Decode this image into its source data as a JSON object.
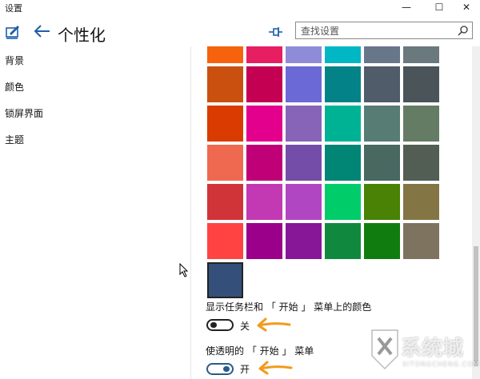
{
  "window": {
    "title": "设置",
    "minimize_glyph": "—",
    "maximize_glyph": "☐",
    "close_glyph": "✕"
  },
  "header": {
    "title": "个性化",
    "back_icon": "back-arrow-icon",
    "app_icon": "personalization-icon",
    "pin_icon": "pin-icon"
  },
  "search": {
    "placeholder": "查找设置",
    "value": "",
    "icon": "search-icon"
  },
  "sidebar": {
    "items": [
      {
        "label": "背景"
      },
      {
        "label": "颜色"
      },
      {
        "label": "锁屏界面"
      },
      {
        "label": "主题"
      }
    ]
  },
  "accent_colors": {
    "rows": [
      [
        "#f7630c",
        "#e81e63",
        "#8e8cd8",
        "#00b7c3",
        "#68768a",
        "#69797e"
      ],
      [
        "#ca5010",
        "#c30052",
        "#6b69d6",
        "#038387",
        "#515c6b",
        "#4a5459"
      ],
      [
        "#da3b01",
        "#e3008c",
        "#8764b8",
        "#00b294",
        "#567c73",
        "#647c64"
      ],
      [
        "#ef6950",
        "#bf0077",
        "#744da9",
        "#018574",
        "#486860",
        "#525e54"
      ],
      [
        "#d13438",
        "#c239b3",
        "#b146c2",
        "#00cc6a",
        "#498205",
        "#847545"
      ],
      [
        "#ff4343",
        "#9a0089",
        "#881798",
        "#10893e",
        "#107c10",
        "#7e735f"
      ],
      [
        "#34507a"
      ]
    ],
    "selected": "#34507a"
  },
  "settings": {
    "taskbar_start_color": {
      "label": "显示任务栏和 「 开始 」 菜单上的颜色",
      "state": "关",
      "on": false
    },
    "transparent_start": {
      "label": "使透明的 「 开始 」 菜单",
      "state": "开",
      "on": true
    }
  },
  "annotations": {
    "arrow_color": "#f39a1c"
  },
  "watermark": {
    "text": "系统城",
    "subtext": "XITONGCHENG.COM"
  }
}
